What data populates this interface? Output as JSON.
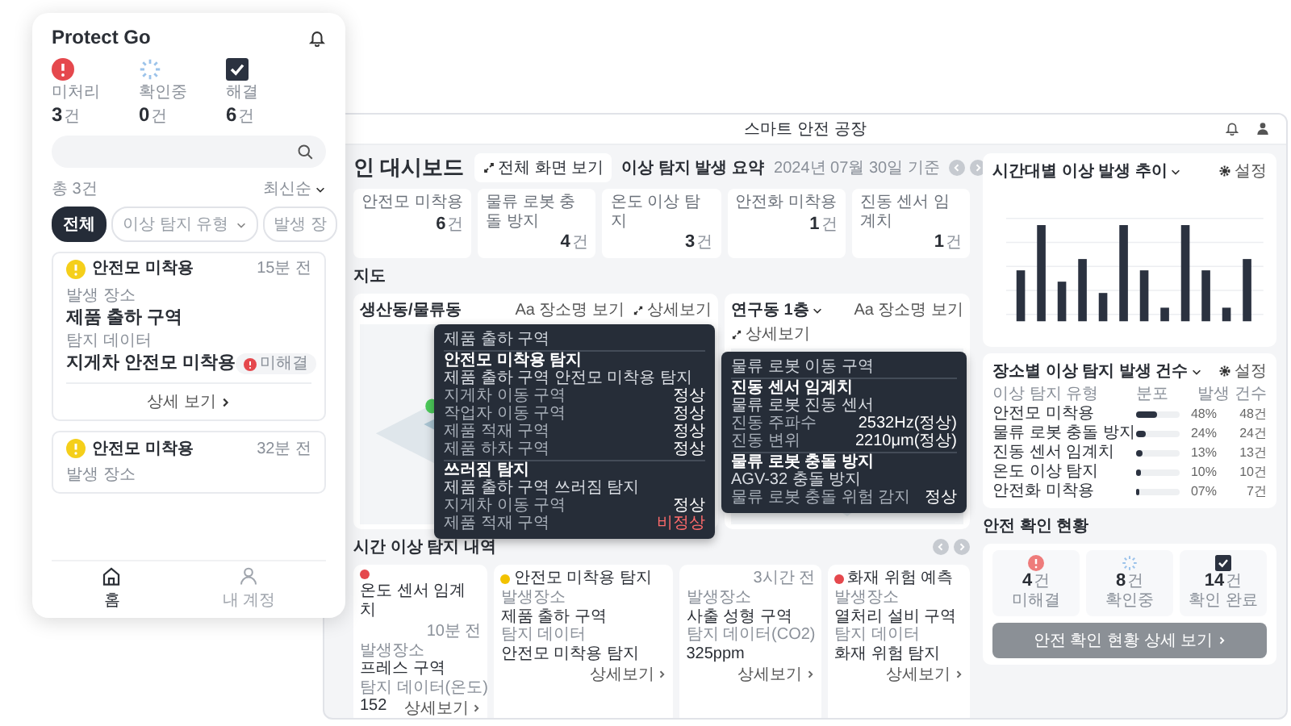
{
  "phone": {
    "app_title": "Protect Go",
    "stats": [
      {
        "kind": "error",
        "label": "미처리",
        "count": "3",
        "unit": "건"
      },
      {
        "kind": "pending",
        "label": "확인중",
        "count": "0",
        "unit": "건"
      },
      {
        "kind": "done",
        "label": "해결",
        "count": "6",
        "unit": "건"
      }
    ],
    "total": "총 3건",
    "sort": "최신순",
    "filters": [
      {
        "label": "전체",
        "selected": true,
        "dropdown": false
      },
      {
        "label": "이상 탐지 유형",
        "selected": false,
        "dropdown": true
      },
      {
        "label": "발생 장",
        "selected": false,
        "dropdown": false
      }
    ],
    "alerts": [
      {
        "title": "안전모 미착용",
        "time": "15분 전",
        "fields": [
          {
            "label": "발생 장소",
            "value": "제품 출하 구역"
          },
          {
            "label": "탐지 데이터",
            "value": "지게차 안전모 미착용"
          }
        ],
        "status": "미해결",
        "link": "상세 보기"
      },
      {
        "title": "안전모 미착용",
        "time": "32분 전",
        "fields": [
          {
            "label": "발생 장소"
          }
        ]
      }
    ],
    "nav": [
      {
        "kind": "home",
        "label": "홈",
        "selected": true
      },
      {
        "kind": "account",
        "label": "내 계정",
        "selected": false
      }
    ]
  },
  "dashboard": {
    "title": "스마트 안전 공장",
    "page_title": "인 대시보드",
    "fullscreen_button": "전체 화면 보기",
    "summary": {
      "title": "이상 탐지 발생 요약",
      "date": "2024년 07월 30일 기준",
      "items": [
        {
          "label": "안전모 미착용",
          "count": "6",
          "unit": "건"
        },
        {
          "label": "물류 로봇 충돌 방지",
          "count": "4",
          "unit": "건"
        },
        {
          "label": "온도 이상 탐지",
          "count": "3",
          "unit": "건"
        },
        {
          "label": "안전화 미착용",
          "count": "1",
          "unit": "건"
        },
        {
          "label": "진동 센서 임계치",
          "count": "1",
          "unit": "건"
        }
      ]
    },
    "map_section": "지도",
    "maps": [
      {
        "title": "생산동/물류동",
        "dropdown": false,
        "name_toggle": "Aa 장소명 보기",
        "detail": "상세보기",
        "tooltip": {
          "area": "제품 출하 구역",
          "sections": [
            {
              "title": "안전모 미착용 탐지",
              "subtitle": "제품 출하 구역 안전모 미착용 탐지",
              "rows": [
                {
                  "label": "지게차 이동 구역",
                  "status": "정상",
                  "alert": false
                },
                {
                  "label": "작업자 이동 구역",
                  "status": "정상",
                  "alert": false
                },
                {
                  "label": "제품 적재 구역",
                  "status": "정상",
                  "alert": false
                },
                {
                  "label": "제품 하차 구역",
                  "status": "정상",
                  "alert": false
                }
              ]
            },
            {
              "title": "쓰러짐 탐지",
              "subtitle": "제품 출하 구역 쓰러짐 탐지",
              "rows": [
                {
                  "label": "지게차 이동 구역",
                  "status": "정상",
                  "alert": false
                },
                {
                  "label": "제품 적재 구역",
                  "status": "비정상",
                  "alert": true
                }
              ]
            }
          ]
        }
      },
      {
        "title": "연구동 1층",
        "dropdown": true,
        "name_toggle": "Aa 장소명 보기",
        "detail": "상세보기",
        "tooltip": {
          "area": "물류 로봇 이동 구역",
          "sections": [
            {
              "title": "진동 센서 임계치",
              "subtitle": "물류 로봇 진동 센서",
              "rows": [
                {
                  "label": "진동 주파수",
                  "status": "2532Hz(정상)",
                  "alert": false
                },
                {
                  "label": "진동 변위",
                  "status": "2210μm(정상)",
                  "alert": false
                }
              ]
            },
            {
              "title": "물류 로봇 충돌 방지",
              "subtitle": "AGV-32 충돌 방지",
              "rows": [
                {
                  "label": "물류 로봇 충돌 위험 감지",
                  "status": "정상",
                  "alert": false
                }
              ]
            }
          ]
        }
      }
    ],
    "realtime": {
      "title": "시간 이상 탐지 내역",
      "items": [
        {
          "title": "온도 센서 임계치",
          "time": "10분 전",
          "color": "#e5484d",
          "place_label": "발생장소",
          "place": "프레스 구역",
          "data_label": "탐지 데이터(온도)",
          "data": "152",
          "link": "상세보기"
        },
        {
          "title": "안전모 미착용 탐지",
          "color": "#f2c200",
          "place_label": "발생장소",
          "place": "제품 출하 구역",
          "data_label": "탐지 데이터",
          "data": "안전모 미착용 탐지",
          "link": "상세보기"
        },
        {
          "time": "3시간 전",
          "place_label": "발생장소",
          "place": "사출 성형 구역",
          "data_label": "탐지 데이터(CO2)",
          "data": "325ppm",
          "link": "상세보기"
        },
        {
          "title": "화재 위험 예측",
          "color": "#e5484d",
          "place_label": "발생장소",
          "place": "열처리 설비 구역",
          "data_label": "탐지 데이터",
          "data": "화재 위험 탐지",
          "link": "상세보기"
        }
      ]
    },
    "hourly_chart": {
      "title": "시간대별 이상 발생 추이",
      "settings": "설정"
    },
    "location_table": {
      "title": "장소별 이상 탐지 발생 건수",
      "settings": "설정",
      "columns": [
        "이상 탐지 유형",
        "분포",
        "발생 건수"
      ],
      "rows": [
        {
          "type": "안전모 미착용",
          "level": 0.48,
          "share": "48%",
          "count": "48건"
        },
        {
          "type": "물류 로봇 충돌 방지",
          "level": 0.24,
          "share": "24%",
          "count": "24건"
        },
        {
          "type": "진동 센서 임계치",
          "level": 0.13,
          "share": "13%",
          "count": "13건"
        },
        {
          "type": "온도 이상 탐지",
          "level": 0.1,
          "share": "10%",
          "count": "10건"
        },
        {
          "type": "안전화 미착용",
          "level": 0.07,
          "share": "07%",
          "count": "7건"
        }
      ]
    },
    "safety": {
      "title": "안전 확인 현황",
      "items": [
        {
          "kind": "error",
          "count": "4",
          "unit": "건",
          "label": "미해결"
        },
        {
          "kind": "pending",
          "count": "8",
          "unit": "건",
          "label": "확인중"
        },
        {
          "kind": "done",
          "count": "14",
          "unit": "건",
          "label": "확인 완료"
        }
      ],
      "button": "안전 확인 현황 상세 보기"
    }
  }
}
